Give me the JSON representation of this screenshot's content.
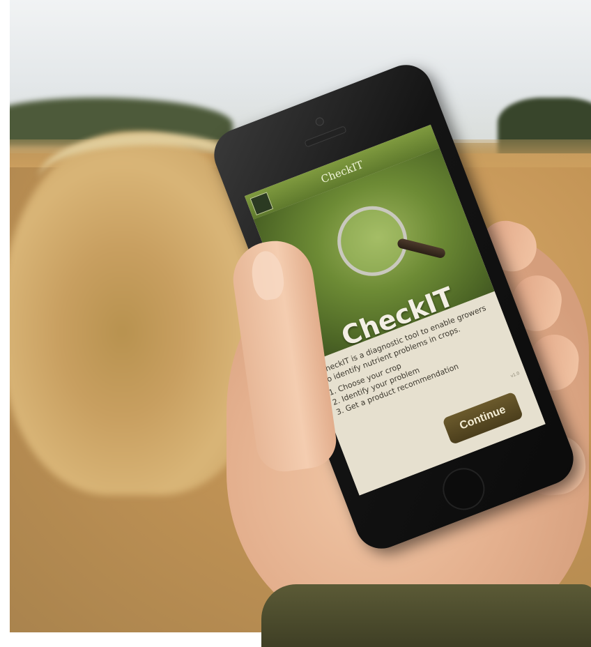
{
  "scene": {
    "description_colors": {
      "sky": "#e6e9eb",
      "field": "#c49556",
      "app_green": "#6d8b35",
      "button_brown": "#5a4a24"
    }
  },
  "app": {
    "header_title": "CheckIT",
    "logo_text": "",
    "brand_title": "CheckIT",
    "intro_text": "CheckIT is a diagnostic tool to enable growers to identify nutrient problems in crops.",
    "steps": [
      "Choose your crop",
      "Identify your problem",
      "Get a product recommendation"
    ],
    "continue_label": "Continue",
    "version_text": "v1.0"
  }
}
